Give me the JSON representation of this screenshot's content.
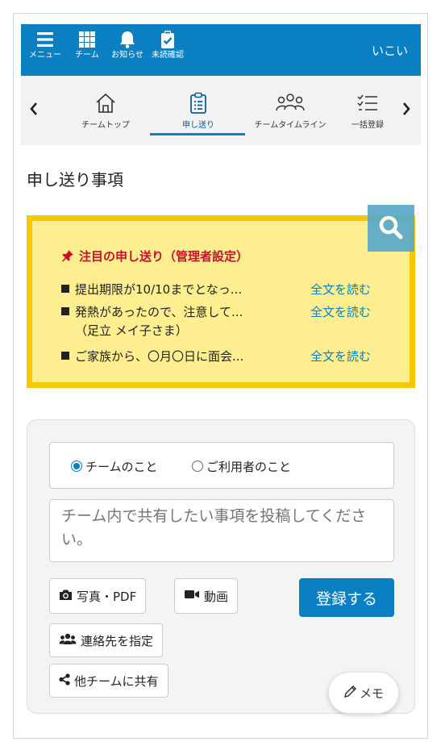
{
  "topbar": {
    "items": [
      {
        "label": "メニュー",
        "icon": "menu-icon"
      },
      {
        "label": "チーム",
        "icon": "grid-icon"
      },
      {
        "label": "お知らせ",
        "icon": "bell-icon"
      },
      {
        "label": "未読確認",
        "icon": "clipboard-check-icon"
      }
    ],
    "user": "いこい",
    "color": "#0a7fc1"
  },
  "subnav": {
    "prev": "‹",
    "next": "›",
    "tabs": [
      {
        "label": "チームトップ",
        "icon": "home-icon"
      },
      {
        "label": "申し送り",
        "icon": "clipboard-list-icon",
        "active": true
      },
      {
        "label": "チームタイムライン",
        "icon": "people-icon"
      },
      {
        "label": "一括登録",
        "icon": "checklist-icon"
      }
    ]
  },
  "page_title": "申し送り事項",
  "pinned": {
    "title": "注目の申し送り（管理者設定）",
    "items": [
      {
        "text": "提出期限が10/10までとなっ...",
        "link": "全文を読む"
      },
      {
        "text": "発熱があったので、注意して...",
        "sub": "（足立 メイ子さま）",
        "link": "全文を読む"
      },
      {
        "text": "ご家族から、〇月〇日に面会...",
        "link": "全文を読む"
      }
    ],
    "colors": {
      "background": "#fdee8f",
      "border": "#f7c800",
      "title": "#c8102e"
    }
  },
  "compose": {
    "radios": [
      {
        "label": "チームのこと",
        "checked": true
      },
      {
        "label": "ご利用者のこと",
        "checked": false
      }
    ],
    "placeholder": "チーム内で共有したい事項を投稿してください。",
    "photo_button": "写真・PDF",
    "video_button": "動画",
    "submit_button": "登録する",
    "contact_button": "連絡先を指定",
    "share_button": "他チームに共有",
    "memo_button": "メモ"
  }
}
